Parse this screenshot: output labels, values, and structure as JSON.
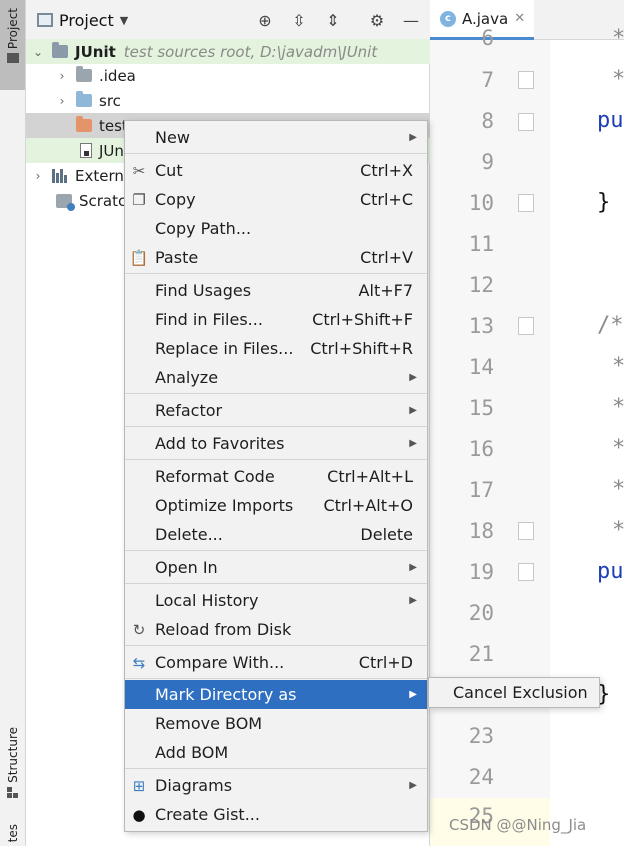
{
  "tool_strip": {
    "project_tab": "Project",
    "structure_tab": "Structure",
    "bottom_tab": "tes"
  },
  "project_panel": {
    "title": "Project",
    "tree": {
      "root_name": "JUnit",
      "root_info": "test sources root,  D:\\javadm\\JUnit",
      "idea": ".idea",
      "src": "src",
      "test": "test",
      "junit_file": "JUn",
      "external": "Extern",
      "scratches": "Scratc"
    }
  },
  "editor": {
    "tab_label": "A.java",
    "tab_icon_letter": "c",
    "line_numbers": [
      "6",
      "7",
      "8",
      "9",
      "10",
      "11",
      "12",
      "13",
      "14",
      "15",
      "16",
      "17",
      "18",
      "19",
      "20",
      "21",
      "23",
      "24",
      "25"
    ],
    "code": {
      "l6": "*",
      "l7": "*",
      "l8": "pu",
      "l10": "}",
      "l13": "/*",
      "l14": "*",
      "l15": "*",
      "l16": "*",
      "l17": "*",
      "l18": "*",
      "l19": "pu",
      "l22": "}"
    }
  },
  "context_menu": {
    "new": "New",
    "cut": "Cut",
    "cut_sc": "Ctrl+X",
    "copy": "Copy",
    "copy_sc": "Ctrl+C",
    "copy_path": "Copy Path...",
    "paste": "Paste",
    "paste_sc": "Ctrl+V",
    "find_usages": "Find Usages",
    "find_usages_sc": "Alt+F7",
    "find_in_files": "Find in Files...",
    "find_in_files_sc": "Ctrl+Shift+F",
    "replace_in_files": "Replace in Files...",
    "replace_in_files_sc": "Ctrl+Shift+R",
    "analyze": "Analyze",
    "refactor": "Refactor",
    "add_favorites": "Add to Favorites",
    "reformat": "Reformat Code",
    "reformat_sc": "Ctrl+Alt+L",
    "optimize": "Optimize Imports",
    "optimize_sc": "Ctrl+Alt+O",
    "delete": "Delete...",
    "delete_sc": "Delete",
    "open_in": "Open In",
    "local_history": "Local History",
    "reload": "Reload from Disk",
    "compare": "Compare With...",
    "compare_sc": "Ctrl+D",
    "mark_dir": "Mark Directory as",
    "remove_bom": "Remove BOM",
    "add_bom": "Add BOM",
    "diagrams": "Diagrams",
    "gist": "Create Gist..."
  },
  "submenu": {
    "cancel_exclusion": "Cancel Exclusion"
  },
  "watermark": "CSDN @@Ning_Jia",
  "colors": {
    "selection_blue": "#2f6fc2",
    "root_row_green": "#e3f3dd",
    "keyword_blue": "#1d3fb3"
  }
}
